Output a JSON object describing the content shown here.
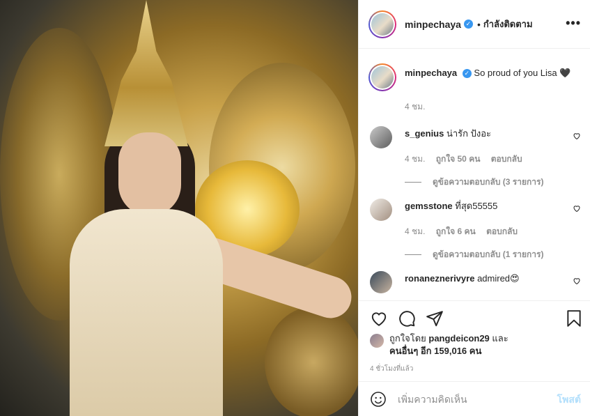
{
  "post": {
    "username": "minpechaya",
    "verified_mark": "✓",
    "separator": "•",
    "follow_status": "กำลังติดตาม",
    "more_label": "•••",
    "photo_icon": "photo-image"
  },
  "caption": {
    "username": "minpechaya",
    "text": "So proud of you Lisa 🖤",
    "time": "4 ชม."
  },
  "comments": [
    {
      "username": "s_genius",
      "text": "น่ารัก ปังอะ",
      "time": "4 ชม.",
      "likes": "ถูกใจ 50 คน",
      "reply": "ตอบกลับ",
      "view_replies": "ดูข้อความตอบกลับ (3 รายการ)"
    },
    {
      "username": "gemsstone",
      "text": "ที่สุด55555",
      "time": "4 ชม.",
      "likes": "ถูกใจ 6 คน",
      "reply": "ตอบกลับ",
      "view_replies": "ดูข้อความตอบกลับ (1 รายการ)"
    },
    {
      "username": "ronaneznerivyre",
      "text": "admired😍"
    }
  ],
  "likes": {
    "prefix": "ถูกใจโดย",
    "user": "pangdeicon29",
    "conj": "และ",
    "others": "คนอื่นๆ อีก 159,016 คน"
  },
  "post_time": "4 ชั่วโมงที่แล้ว",
  "add_comment": {
    "placeholder": "เพิ่มความคิดเห็น",
    "post_label": "โพสต์"
  },
  "colors": {
    "verified": "#3897f0",
    "post_button_disabled": "#b2dffc",
    "muted_text": "#8e8e8e"
  }
}
